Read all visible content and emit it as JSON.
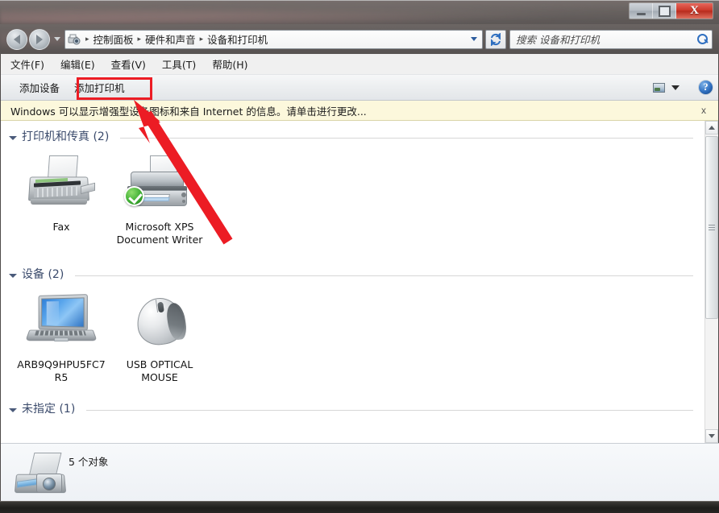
{
  "window": {
    "controls": {
      "minimize": "–",
      "maximize": "□",
      "close": "X"
    }
  },
  "navbar": {
    "back_icon": "back-arrow-icon",
    "forward_icon": "forward-arrow-icon",
    "history_icon": "chevron-down-icon",
    "address_icon": "devices-and-printers-icon",
    "breadcrumbs": [
      {
        "label": "控制面板"
      },
      {
        "label": "硬件和声音"
      },
      {
        "label": "设备和打印机"
      }
    ],
    "separator": "▸",
    "refresh_icon": "refresh-icon",
    "refresh_glyph": "↺",
    "search": {
      "placeholder": "搜索 设备和打印机",
      "value": "",
      "icon": "search-icon"
    }
  },
  "menubar": {
    "items": [
      {
        "label": "文件(F)"
      },
      {
        "label": "编辑(E)"
      },
      {
        "label": "查看(V)"
      },
      {
        "label": "工具(T)"
      },
      {
        "label": "帮助(H)"
      }
    ]
  },
  "toolbar": {
    "add_device_label": "添加设备",
    "add_printer_label": "添加打印机",
    "view_icon": "change-view-icon",
    "view_caret_icon": "chevron-down-icon",
    "help_label": "?",
    "help_icon": "help-icon"
  },
  "infobar": {
    "message": "Windows 可以显示增强型设备图标和来自 Internet 的信息。请单击进行更改...",
    "close_label": "x",
    "close_icon": "close-icon",
    "background_color": "#fcf8dc"
  },
  "content": {
    "groups": [
      {
        "title": "打印机和传真 (2)",
        "collapse_icon": "triangle-collapse-icon",
        "items": [
          {
            "label": "Fax",
            "icon": "fax-machine-icon",
            "default_badge": false
          },
          {
            "label": "Microsoft XPS Document Writer",
            "icon": "printer-icon",
            "default_badge": true,
            "badge_icon": "green-check-badge-icon"
          }
        ]
      },
      {
        "title": "设备 (2)",
        "collapse_icon": "triangle-collapse-icon",
        "items": [
          {
            "label": "ARB9Q9HPU5FC7R5",
            "icon": "laptop-icon",
            "default_badge": false
          },
          {
            "label": "USB OPTICAL MOUSE",
            "icon": "mouse-icon",
            "default_badge": false
          }
        ]
      },
      {
        "title": "未指定 (1)",
        "collapse_icon": "triangle-collapse-icon",
        "items": []
      }
    ]
  },
  "details_pane": {
    "icon": "scanner-camera-icon",
    "text": "5 个对象"
  },
  "scrollbar": {
    "up_icon": "scroll-up-arrow-icon",
    "down_icon": "scroll-down-arrow-icon",
    "thumb": "scrollbar-thumb"
  },
  "annotation": {
    "highlight_color": "#ec1c24",
    "highlight_target": "添加打印机",
    "arrow_name": "red-pointer-arrow"
  }
}
